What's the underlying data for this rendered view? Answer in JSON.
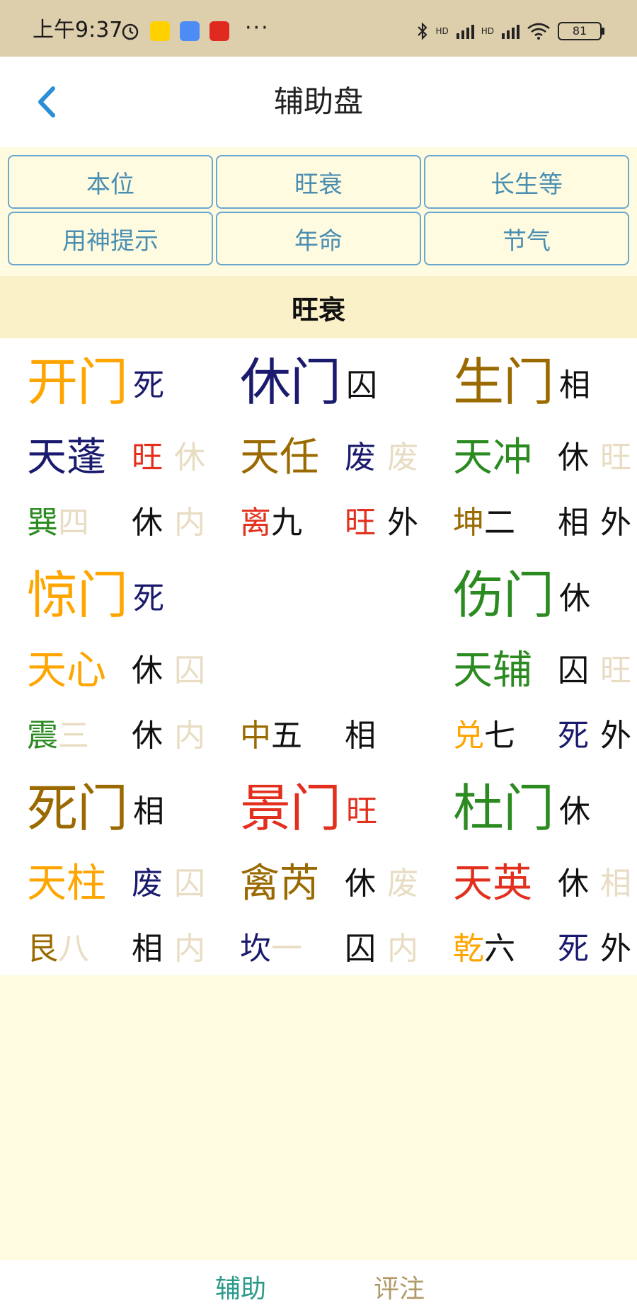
{
  "status_bar": {
    "time": "上午9:37",
    "dots": "···",
    "battery": "81",
    "signal_1": "HD",
    "signal_2": "HD"
  },
  "header": {
    "title": "辅助盘"
  },
  "tabs": [
    {
      "label": "本位"
    },
    {
      "label": "旺衰"
    },
    {
      "label": "长生等"
    },
    {
      "label": "用神提示"
    },
    {
      "label": "年命"
    },
    {
      "label": "节气"
    }
  ],
  "section": {
    "title": "旺衰"
  },
  "palaces": [
    {
      "door": "开门",
      "door_color": "#ffa500",
      "door_state": "死",
      "door_state_color": "#1a1a6e",
      "star": "天蓬",
      "star_color": "#1a1a6e",
      "star_state": "旺",
      "star_state_color": "#e3301e",
      "star_extra": "休",
      "star_extra_color": "#e8dcc3",
      "gua": "巽",
      "gua_color": "#2b8a20",
      "gua_num": "四",
      "gua_num_color": "#e8dcc3",
      "gua_state": "休",
      "gua_state_color": "#111111",
      "gua_pos": "内",
      "gua_pos_color": "#e8dcc3"
    },
    {
      "door": "休门",
      "door_color": "#1a1a6e",
      "door_state": "囚",
      "door_state_color": "#111111",
      "star": "天任",
      "star_color": "#9a6a00",
      "star_state": "废",
      "star_state_color": "#1a1a6e",
      "star_extra": "废",
      "star_extra_color": "#e8dcc3",
      "gua": "离",
      "gua_color": "#e3301e",
      "gua_num": "九",
      "gua_num_color": "#111111",
      "gua_state": "旺",
      "gua_state_color": "#e3301e",
      "gua_pos": "外",
      "gua_pos_color": "#111111"
    },
    {
      "door": "生门",
      "door_color": "#9a6a00",
      "door_state": "相",
      "door_state_color": "#111111",
      "star": "天冲",
      "star_color": "#2b8a20",
      "star_state": "休",
      "star_state_color": "#111111",
      "star_extra": "旺",
      "star_extra_color": "#e8dcc3",
      "gua": "坤",
      "gua_color": "#9a6a00",
      "gua_num": "二",
      "gua_num_color": "#111111",
      "gua_state": "相",
      "gua_state_color": "#111111",
      "gua_pos": "外",
      "gua_pos_color": "#111111"
    },
    {
      "door": "惊门",
      "door_color": "#ffa500",
      "door_state": "死",
      "door_state_color": "#1a1a6e",
      "star": "天心",
      "star_color": "#ffa500",
      "star_state": "休",
      "star_state_color": "#111111",
      "star_extra": "囚",
      "star_extra_color": "#e8dcc3",
      "gua": "震",
      "gua_color": "#2b8a20",
      "gua_num": "三",
      "gua_num_color": "#e8dcc3",
      "gua_state": "休",
      "gua_state_color": "#111111",
      "gua_pos": "内",
      "gua_pos_color": "#e8dcc3"
    },
    {
      "door": "",
      "door_color": "#111111",
      "door_state": "",
      "door_state_color": "#111111",
      "star": "",
      "star_color": "#111111",
      "star_state": "",
      "star_state_color": "#111111",
      "star_extra": "",
      "star_extra_color": "#e8dcc3",
      "gua": "中",
      "gua_color": "#9a6a00",
      "gua_num": "五",
      "gua_num_color": "#111111",
      "gua_state": "相",
      "gua_state_color": "#111111",
      "gua_pos": "",
      "gua_pos_color": "#111111"
    },
    {
      "door": "伤门",
      "door_color": "#2b8a20",
      "door_state": "休",
      "door_state_color": "#111111",
      "star": "天辅",
      "star_color": "#2b8a20",
      "star_state": "囚",
      "star_state_color": "#111111",
      "star_extra": "旺",
      "star_extra_color": "#e8dcc3",
      "gua": "兑",
      "gua_color": "#ffa500",
      "gua_num": "七",
      "gua_num_color": "#111111",
      "gua_state": "死",
      "gua_state_color": "#1a1a6e",
      "gua_pos": "外",
      "gua_pos_color": "#111111"
    },
    {
      "door": "死门",
      "door_color": "#9a6a00",
      "door_state": "相",
      "door_state_color": "#111111",
      "star": "天柱",
      "star_color": "#ffa500",
      "star_state": "废",
      "star_state_color": "#1a1a6e",
      "star_extra": "囚",
      "star_extra_color": "#e8dcc3",
      "gua": "艮",
      "gua_color": "#9a6a00",
      "gua_num": "八",
      "gua_num_color": "#e8dcc3",
      "gua_state": "相",
      "gua_state_color": "#111111",
      "gua_pos": "内",
      "gua_pos_color": "#e8dcc3"
    },
    {
      "door": "景门",
      "door_color": "#e3301e",
      "door_state": "旺",
      "door_state_color": "#e3301e",
      "star": "禽芮",
      "star_color": "#9a6a00",
      "star_state": "休",
      "star_state_color": "#111111",
      "star_extra": "废",
      "star_extra_color": "#e8dcc3",
      "gua": "坎",
      "gua_color": "#1a1a6e",
      "gua_num": "一",
      "gua_num_color": "#e8dcc3",
      "gua_state": "囚",
      "gua_state_color": "#111111",
      "gua_pos": "内",
      "gua_pos_color": "#e8dcc3"
    },
    {
      "door": "杜门",
      "door_color": "#2b8a20",
      "door_state": "休",
      "door_state_color": "#111111",
      "star": "天英",
      "star_color": "#e3301e",
      "star_state": "休",
      "star_state_color": "#111111",
      "star_extra": "相",
      "star_extra_color": "#e8dcc3",
      "gua": "乾",
      "gua_color": "#ffa500",
      "gua_num": "六",
      "gua_num_color": "#111111",
      "gua_state": "死",
      "gua_state_color": "#1a1a6e",
      "gua_pos": "外",
      "gua_pos_color": "#111111"
    }
  ],
  "bottom_nav": {
    "items": [
      {
        "label": "辅助",
        "color": "#2a9a8a"
      },
      {
        "label": "评注",
        "color": "#b09a68"
      }
    ]
  },
  "colors": {
    "accent": "#4a8fb2",
    "background": "#fffbe1",
    "status_bar": "#ddceac",
    "section_bar": "#fbf1c9"
  }
}
